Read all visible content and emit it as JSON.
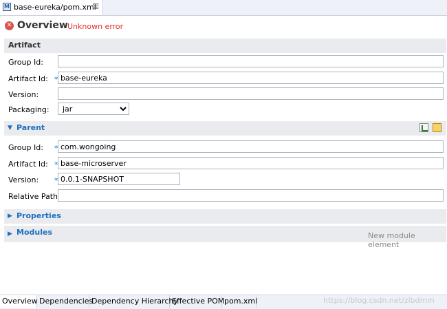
{
  "editor_tab": {
    "label": "base-eureka/pom.xml",
    "close": "☒"
  },
  "header": {
    "title": "Overview",
    "error": "Unknown error"
  },
  "artifact": {
    "section_title": "Artifact",
    "group_id": {
      "label": "Group Id:",
      "value": ""
    },
    "artifact_id": {
      "label": "Artifact Id:",
      "value": "base-eureka"
    },
    "version": {
      "label": "Version:",
      "value": ""
    },
    "packaging": {
      "label": "Packaging:",
      "value": "jar"
    }
  },
  "parent": {
    "section_title": "Parent",
    "group_id": {
      "label": "Group Id:",
      "value": "com.wongoing"
    },
    "artifact_id": {
      "label": "Artifact Id:",
      "value": "base-microserver"
    },
    "version": {
      "label": "Version:",
      "value": "0.0.1-SNAPSHOT"
    },
    "relative_path": {
      "label": "Relative Path:",
      "value": ""
    }
  },
  "properties": {
    "section_title": "Properties"
  },
  "modules": {
    "section_title": "Modules",
    "hint": "New module element"
  },
  "required_marker": "*",
  "bottom_tabs": [
    "Overview",
    "Dependencies",
    "Dependency Hierarchy",
    "Effective POM",
    "pom.xml"
  ],
  "watermark": "https://blog.csdn.net/zlbdmm",
  "colors": {
    "accent": "#1f6fbf",
    "error": "#e0302a",
    "section_bg": "#e9ebee"
  }
}
